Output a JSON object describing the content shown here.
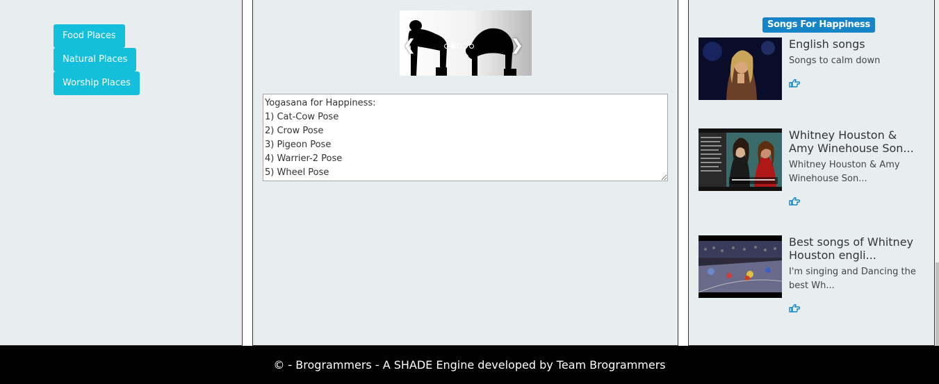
{
  "left_nav": {
    "items": [
      {
        "label": "Food Places"
      },
      {
        "label": "Natural Places"
      },
      {
        "label": "Worship Places"
      }
    ]
  },
  "carousel": {
    "image_subject": "cat-cow yoga pose silhouettes",
    "prev_icon": "chevron-left-icon",
    "next_icon": "chevron-right-icon",
    "slide_count": 5,
    "active_slide": 1
  },
  "yoga_text": {
    "value": "Yogasana for Happiness:\n1) Cat-Cow Pose\n2) Crow Pose\n3) Pigeon Pose\n4) Warrier-2 Pose\n5) Wheel Pose"
  },
  "songs": {
    "badge": "Songs For Happiness",
    "items": [
      {
        "title": "English songs",
        "desc": "Songs to calm down",
        "icon": "hand-point-right-icon"
      },
      {
        "title": "Whitney Houston & Amy Winehouse Son...",
        "desc": "Whitney Houston & Amy Winehouse Son...",
        "icon": "hand-point-right-icon"
      },
      {
        "title": "Best songs of Whitney Houston engli...",
        "desc": "I'm singing and Dancing the best Wh...",
        "icon": "hand-point-right-icon"
      }
    ]
  },
  "footer": {
    "text": "© - Brogrammers - A SHADE Engine developed by Team Brogrammers"
  },
  "colors": {
    "panel_bg": "#e8eef0",
    "nav_button": "#14bfdc",
    "badge": "#1684c6",
    "footer_bg": "#000000"
  }
}
